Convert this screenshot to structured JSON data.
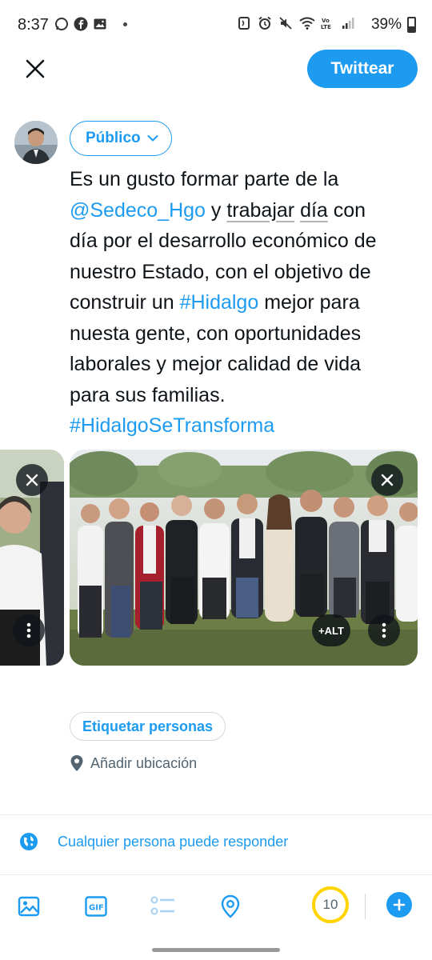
{
  "status_bar": {
    "time": "8:37",
    "battery_percent": "39%",
    "left_icons": [
      "whatsapp-icon",
      "facebook-icon",
      "gallery-icon",
      "more-dot-icon"
    ],
    "right_icons": [
      "nfc-icon",
      "alarm-icon",
      "mute-icon",
      "wifi-icon",
      "volte-icon",
      "signal-icon",
      "battery-icon"
    ]
  },
  "header": {
    "close_icon": "close-icon",
    "tweet_button_label": "Twittear"
  },
  "composer": {
    "audience_label": "Público",
    "text": {
      "line1": "Es un gusto formar parte de la",
      "mention": "@Sedeco_Hgo",
      "line2_a": " y ",
      "line2_u1": "trabajar",
      "line2_sp": " ",
      "line2_u2": "día",
      "line2_b": " con",
      "line3": "día por el desarrollo económico de",
      "line4": "nuestro Estado, con el objetivo de",
      "line5_a": "construir un ",
      "hashtag1": "#Hidalgo",
      "line5_b": " mejor para",
      "line6": "nuesta gente, con oportunidades",
      "line7": "laborales y mejor calidad de vida",
      "line8": "para sus familias.",
      "hashtag2": "#HidalgoSeTransforma"
    }
  },
  "media": {
    "alt_label": "+ALT",
    "remove_icon": "close-icon",
    "more_icon": "more-vertical-icon"
  },
  "tag_people_label": "Etiquetar personas",
  "add_location_label": "Añadir ubicación",
  "reply_setting_label": "Cualquier persona puede responder",
  "toolbar": {
    "char_counter": "10",
    "icons": [
      "image-icon",
      "gif-icon",
      "poll-icon",
      "location-icon",
      "add-icon"
    ]
  },
  "colors": {
    "accent": "#1d9bf0",
    "counter_ring": "#ffd400",
    "text_primary": "#0f1419",
    "text_secondary": "#536471"
  }
}
